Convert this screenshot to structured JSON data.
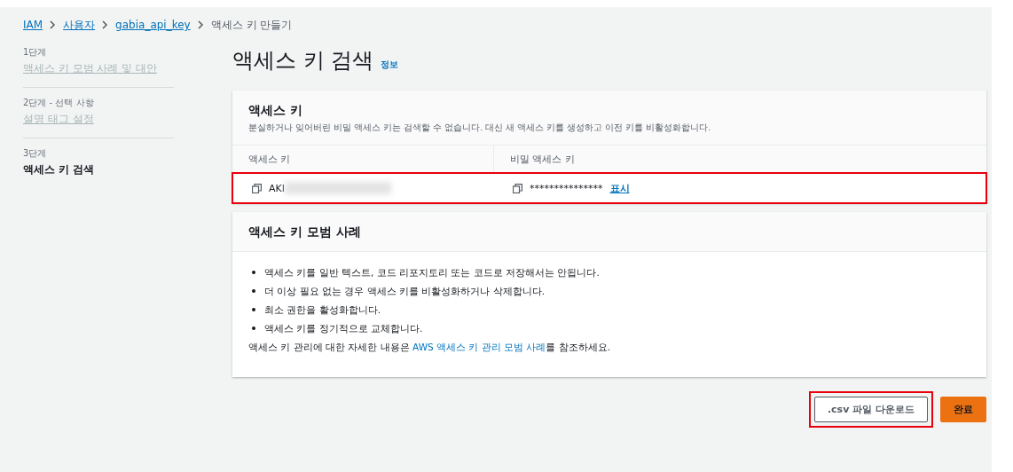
{
  "breadcrumb": [
    {
      "label": "IAM",
      "link": true
    },
    {
      "label": "사용자",
      "link": true
    },
    {
      "label": "gabia_api_key",
      "link": true
    },
    {
      "label": "액세스 키 만들기",
      "link": false
    }
  ],
  "steps": [
    {
      "step": "1단계",
      "label": "액세스 키 모범 사례 및 대안",
      "selected": false
    },
    {
      "step": "2단계 - 선택 사항",
      "label": "설명 태그 설정",
      "selected": false
    },
    {
      "step": "3단계",
      "label": "액세스 키 검색",
      "selected": true
    }
  ],
  "page": {
    "title": "액세스 키 검색",
    "info": "정보"
  },
  "keys_card": {
    "title": "액세스 키",
    "description": "분실하거나 잊어버린 비밀 액세스 키는 검색할 수 없습니다. 대신 새 액세스 키를 생성하고 이전 키를 비활성화합니다.",
    "columns": [
      "액세스 키",
      "비밀 액세스 키"
    ],
    "access_key": "AKI",
    "secret_key": "***************",
    "show_link": "표시",
    "highlighted": true
  },
  "practices_card": {
    "title": "액세스 키 모범 사례",
    "items": [
      "액세스 키를 일반 텍스트, 코드 리포지토리 또는 코드로 저장해서는 안됩니다.",
      "더 이상 필요 없는 경우 액세스 키를 비활성화하거나 삭제합니다.",
      "최소 권한을 활성화합니다.",
      "액세스 키를 정기적으로 교체합니다."
    ],
    "footer_before": "액세스 키 관리에 대한 자세한 내용은 ",
    "footer_link": "AWS 액세스 키 관리 모범 사례",
    "footer_after": "를 참조하세요."
  },
  "actions": [
    {
      "label": ".csv 파일 다운로드",
      "kind": "secondary",
      "highlighted": true
    },
    {
      "label": "완료",
      "kind": "primary",
      "highlighted": false
    }
  ]
}
